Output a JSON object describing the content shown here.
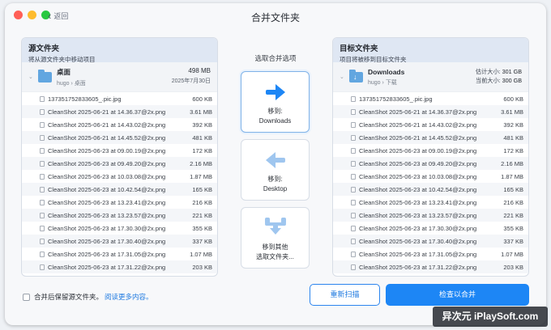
{
  "window": {
    "title": "合并文件夹",
    "back_label": "返回"
  },
  "source": {
    "header": "源文件夹",
    "subheader": "将从源文件夹中移动项目",
    "folder": {
      "name": "桌面",
      "user": "hugo",
      "location": "桌面",
      "size": "498 MB",
      "date": "2025年7月30日"
    },
    "files": [
      {
        "name": "137351752833605_.pic.jpg",
        "size": "600 KB"
      },
      {
        "name": "CleanShot 2025-06-21 at 14.36.37@2x.png",
        "size": "3.61 MB"
      },
      {
        "name": "CleanShot 2025-06-21 at 14.43.02@2x.png",
        "size": "392 KB"
      },
      {
        "name": "CleanShot 2025-06-21 at 14.45.52@2x.png",
        "size": "481 KB"
      },
      {
        "name": "CleanShot 2025-06-23 at 09.00.19@2x.png",
        "size": "172 KB"
      },
      {
        "name": "CleanShot 2025-06-23 at 09.49.20@2x.png",
        "size": "2.16 MB"
      },
      {
        "name": "CleanShot 2025-06-23 at 10.03.08@2x.png",
        "size": "1.87 MB"
      },
      {
        "name": "CleanShot 2025-06-23 at 10.42.54@2x.png",
        "size": "165 KB"
      },
      {
        "name": "CleanShot 2025-06-23 at 13.23.41@2x.png",
        "size": "216 KB"
      },
      {
        "name": "CleanShot 2025-06-23 at 13.23.57@2x.png",
        "size": "221 KB"
      },
      {
        "name": "CleanShot 2025-06-23 at 17.30.30@2x.png",
        "size": "355 KB"
      },
      {
        "name": "CleanShot 2025-06-23 at 17.30.40@2x.png",
        "size": "337 KB"
      },
      {
        "name": "CleanShot 2025-06-23 at 17.31.05@2x.png",
        "size": "1.07 MB"
      },
      {
        "name": "CleanShot 2025-06-23 at 17.31.22@2x.png",
        "size": "203 KB"
      }
    ]
  },
  "options": {
    "title": "选取合并选项",
    "move_to_target_line1": "移到:",
    "move_to_target_line2": "Downloads",
    "move_to_source_line1": "移到:",
    "move_to_source_line2": "Desktop",
    "move_to_other_line1": "移到其他",
    "move_to_other_line2": "选取文件夹..."
  },
  "target": {
    "header": "目标文件夹",
    "subheader": "项目将被移到目标文件夹",
    "folder": {
      "name": "Downloads",
      "user": "hugo",
      "location": "下载",
      "est_label": "估计大小:",
      "est_value": "301 GB",
      "cur_label": "当前大小:",
      "cur_value": "300 GB"
    },
    "files": [
      {
        "name": "137351752833605_.pic.jpg",
        "size": "600 KB"
      },
      {
        "name": "CleanShot 2025-06-21 at 14.36.37@2x.png",
        "size": "3.61 MB"
      },
      {
        "name": "CleanShot 2025-06-21 at 14.43.02@2x.png",
        "size": "392 KB"
      },
      {
        "name": "CleanShot 2025-06-21 at 14.45.52@2x.png",
        "size": "481 KB"
      },
      {
        "name": "CleanShot 2025-06-23 at 09.00.19@2x.png",
        "size": "172 KB"
      },
      {
        "name": "CleanShot 2025-06-23 at 09.49.20@2x.png",
        "size": "2.16 MB"
      },
      {
        "name": "CleanShot 2025-06-23 at 10.03.08@2x.png",
        "size": "1.87 MB"
      },
      {
        "name": "CleanShot 2025-06-23 at 10.42.54@2x.png",
        "size": "165 KB"
      },
      {
        "name": "CleanShot 2025-06-23 at 13.23.41@2x.png",
        "size": "216 KB"
      },
      {
        "name": "CleanShot 2025-06-23 at 13.23.57@2x.png",
        "size": "221 KB"
      },
      {
        "name": "CleanShot 2025-06-23 at 17.30.30@2x.png",
        "size": "355 KB"
      },
      {
        "name": "CleanShot 2025-06-23 at 17.30.40@2x.png",
        "size": "337 KB"
      },
      {
        "name": "CleanShot 2025-06-23 at 17.31.05@2x.png",
        "size": "1.07 MB"
      },
      {
        "name": "CleanShot 2025-06-23 at 17.31.22@2x.png",
        "size": "203 KB"
      }
    ]
  },
  "footer": {
    "keep_source_label": "合并后保留源文件夹。",
    "learn_more": "阅读更多内容。",
    "rescan": "重新扫描",
    "check_merge": "检查以合并"
  },
  "watermark": "异次元 iPlaySoft.com",
  "colors": {
    "accent": "#1d86f5",
    "panel_header": "#dfe7f3",
    "folder": "#62a6e0"
  }
}
